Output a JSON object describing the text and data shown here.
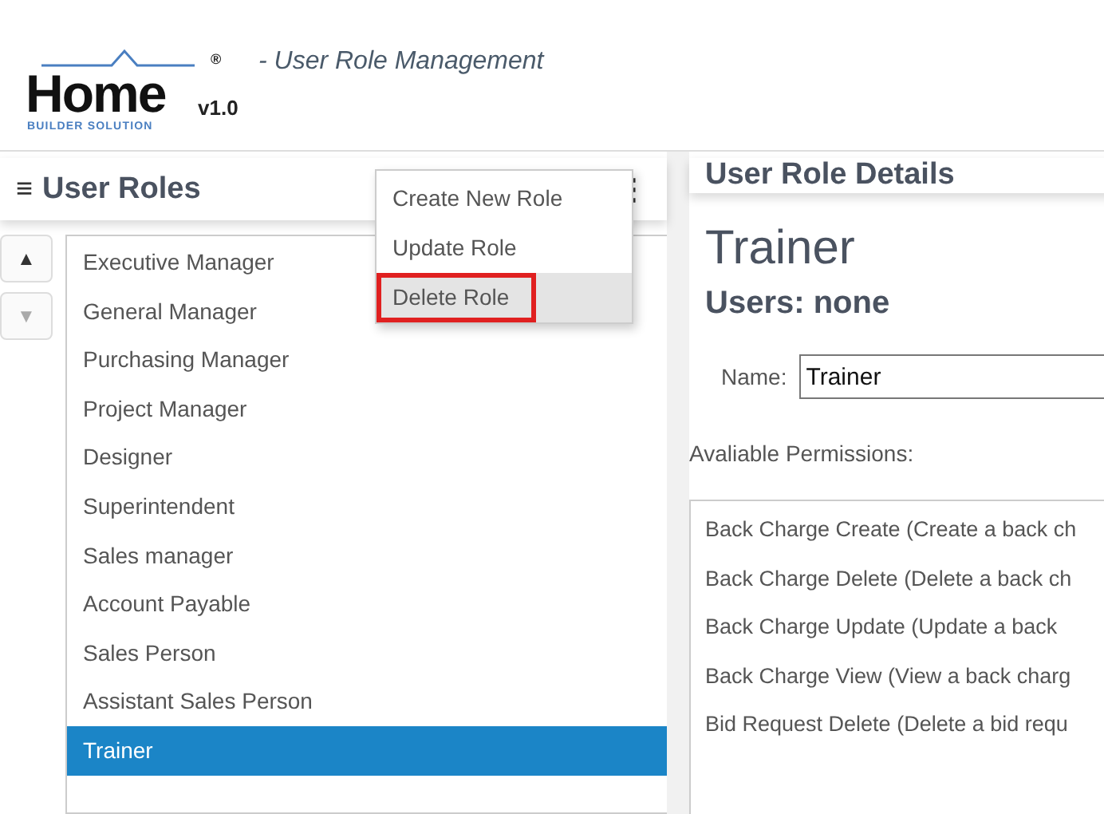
{
  "logo": {
    "word": "Home",
    "tagline": "BUILDER SOLUTION",
    "mark": "®",
    "version": "v1.0"
  },
  "page_title": "- User Role Management",
  "roles_panel": {
    "menu_icon": "≡",
    "title": "User Roles",
    "more_icon": "⋮",
    "move_buttons": [
      {
        "label": "▲",
        "disabled": false
      },
      {
        "label": "▼",
        "disabled": true
      }
    ],
    "items": [
      {
        "label": "Executive Manager",
        "selected": false
      },
      {
        "label": "General Manager",
        "selected": false
      },
      {
        "label": "Purchasing Manager",
        "selected": false
      },
      {
        "label": "Project Manager",
        "selected": false
      },
      {
        "label": "Designer",
        "selected": false
      },
      {
        "label": "Superintendent",
        "selected": false
      },
      {
        "label": "Sales manager",
        "selected": false
      },
      {
        "label": "Account Payable",
        "selected": false
      },
      {
        "label": "Sales Person",
        "selected": false
      },
      {
        "label": "Assistant Sales Person",
        "selected": false
      },
      {
        "label": "Trainer",
        "selected": true
      }
    ],
    "menu": [
      {
        "label": "Create New Role",
        "selected": false
      },
      {
        "label": "Update Role",
        "selected": false
      },
      {
        "label": "Delete Role",
        "selected": true
      }
    ]
  },
  "details_panel": {
    "title": "User Role Details",
    "role_name": "Trainer",
    "users": "Users: none",
    "name_label": "Name:",
    "name_value": "Trainer",
    "permissions_label": "Avaliable Permissions:",
    "permissions": [
      "Back Charge Create (Create a back ch",
      "Back Charge Delete (Delete a back ch",
      "Back Charge Update (Update a back",
      "Back Charge View (View a back charg",
      "Bid Request Delete (Delete a bid requ"
    ]
  }
}
